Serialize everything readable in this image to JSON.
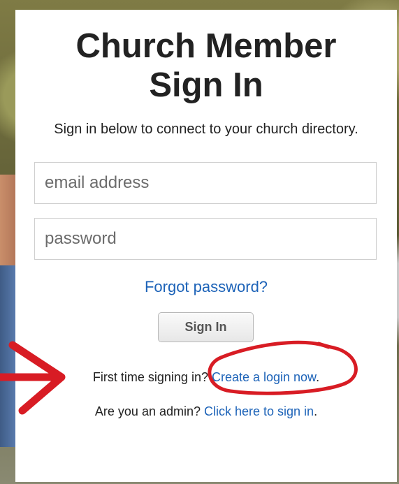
{
  "title_line1": "Church Member",
  "title_line2": "Sign In",
  "subtitle": "Sign in below to connect to your church directory.",
  "email": {
    "placeholder": "email address",
    "value": ""
  },
  "password": {
    "placeholder": "password",
    "value": ""
  },
  "forgot_label": "Forgot password?",
  "signin_label": "Sign In",
  "first_time": {
    "prefix": "First time signing in? ",
    "link": "Create a login now",
    "suffix": "."
  },
  "admin": {
    "prefix": "Are you an admin? ",
    "link": "Click here to sign in",
    "suffix": "."
  },
  "colors": {
    "link": "#1d63b8",
    "annotation": "#d81c24"
  }
}
